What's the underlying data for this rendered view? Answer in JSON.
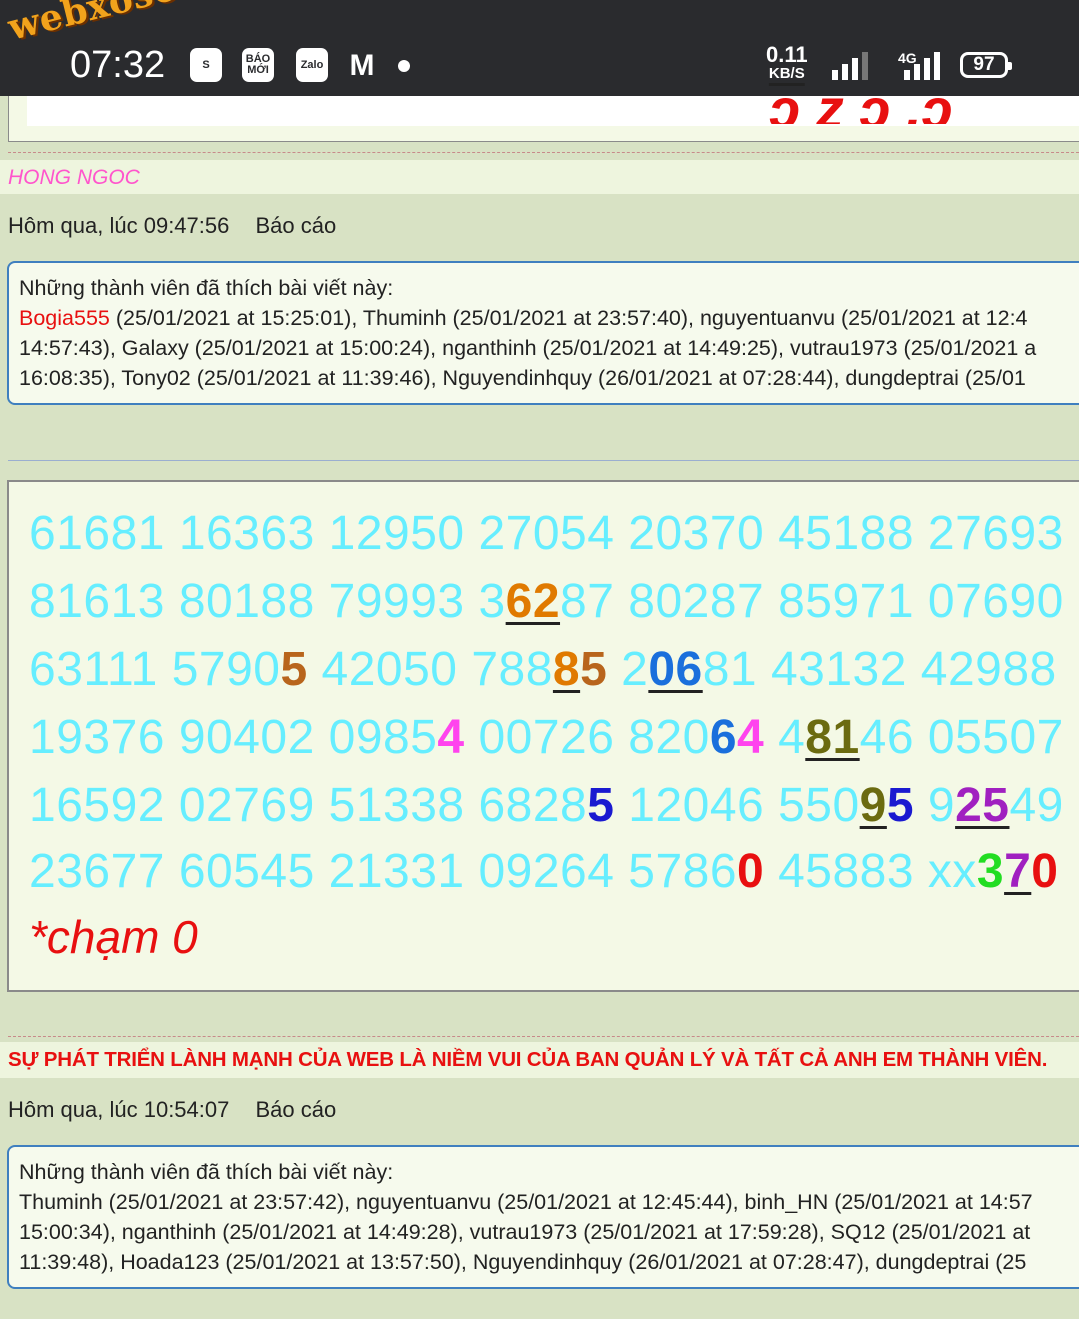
{
  "status_bar": {
    "time": "07:32",
    "watermark": "webxoso.net",
    "app_icons": [
      "S",
      "BÁO MỚI",
      "Zalo",
      "M"
    ],
    "net_speed_value": "0.11",
    "net_speed_unit": "KB/S",
    "network_type": "4G",
    "battery": "97"
  },
  "post1": {
    "username": "HONG NGOC",
    "timestamp": "Hôm qua, lúc 09:47:56",
    "report_label": "Báo cáo",
    "likes_title": "Những thành viên đã thích bài viết này:",
    "likes_line1_first": "Bogia555",
    "likes_line1_rest": " (25/01/2021 at 15:25:01), Thuminh (25/01/2021 at 23:57:40), nguyentuanvu (25/01/2021 at 12:4",
    "likes_line2": "14:57:43), Galaxy (25/01/2021 at 15:00:24), nganthinh (25/01/2021 at 14:49:25), vutrau1973 (25/01/2021 a",
    "likes_line3": "16:08:35), Tony02 (25/01/2021 at 11:39:46), Nguyendinhquy (26/01/2021 at 07:28:44), dungdeptrai (25/01"
  },
  "post2": {
    "numbers": [
      [
        "61681 16363 12950 27054 20370 45188 27693"
      ],
      [
        "81613 80188 79993 3",
        "62",
        "87 80287 85971 07690"
      ],
      [
        "63111 5790",
        "5",
        " 42050 788",
        "8",
        "5",
        " 2",
        "06",
        "81 43132 42988"
      ],
      [
        "19376 90402 0985",
        "4",
        " 00726 820",
        "6",
        "4",
        " 4",
        "81",
        "46 05507"
      ],
      [
        "16592 02769 51338 6828",
        "5",
        " 12046 550",
        "9",
        "5",
        " 9",
        "25",
        "49"
      ],
      [
        "23677 60545 21331 09264 5786",
        "0",
        " 45883 xx",
        "3",
        "7",
        "0"
      ]
    ],
    "note": "*chạm 0",
    "colors": {
      "base": "#66eeff",
      "orange": "#e07a00",
      "brown": "#b8651c",
      "blue": "#1a6fdc",
      "magenta": "#ff44ee",
      "olive": "#6b6b10",
      "navy": "#1a1ad0",
      "purple": "#a020c0",
      "red": "#e81010",
      "green": "#22dd22"
    }
  },
  "post3": {
    "headline": "SỰ PHÁT TRIỂN LÀNH MẠNH CỦA WEB LÀ NIỀM VUI CỦA BAN QUẢN LÝ VÀ TẤT CẢ ANH EM THÀNH VIÊN.",
    "timestamp": "Hôm qua, lúc 10:54:07",
    "report_label": "Báo cáo",
    "likes_title": "Những thành viên đã thích bài viết này:",
    "likes_line1": "Thuminh (25/01/2021 at 23:57:42), nguyentuanvu (25/01/2021 at 12:45:44), binh_HN (25/01/2021 at 14:57",
    "likes_line2": "15:00:34), nganthinh (25/01/2021 at 14:49:28), vutrau1973 (25/01/2021 at 17:59:28), SQ12 (25/01/2021 at",
    "likes_line3": "11:39:48), Hoada123 (25/01/2021 at 13:57:50), Nguyendinhquy (26/01/2021 at 07:28:47), dungdeptrai (25"
  }
}
